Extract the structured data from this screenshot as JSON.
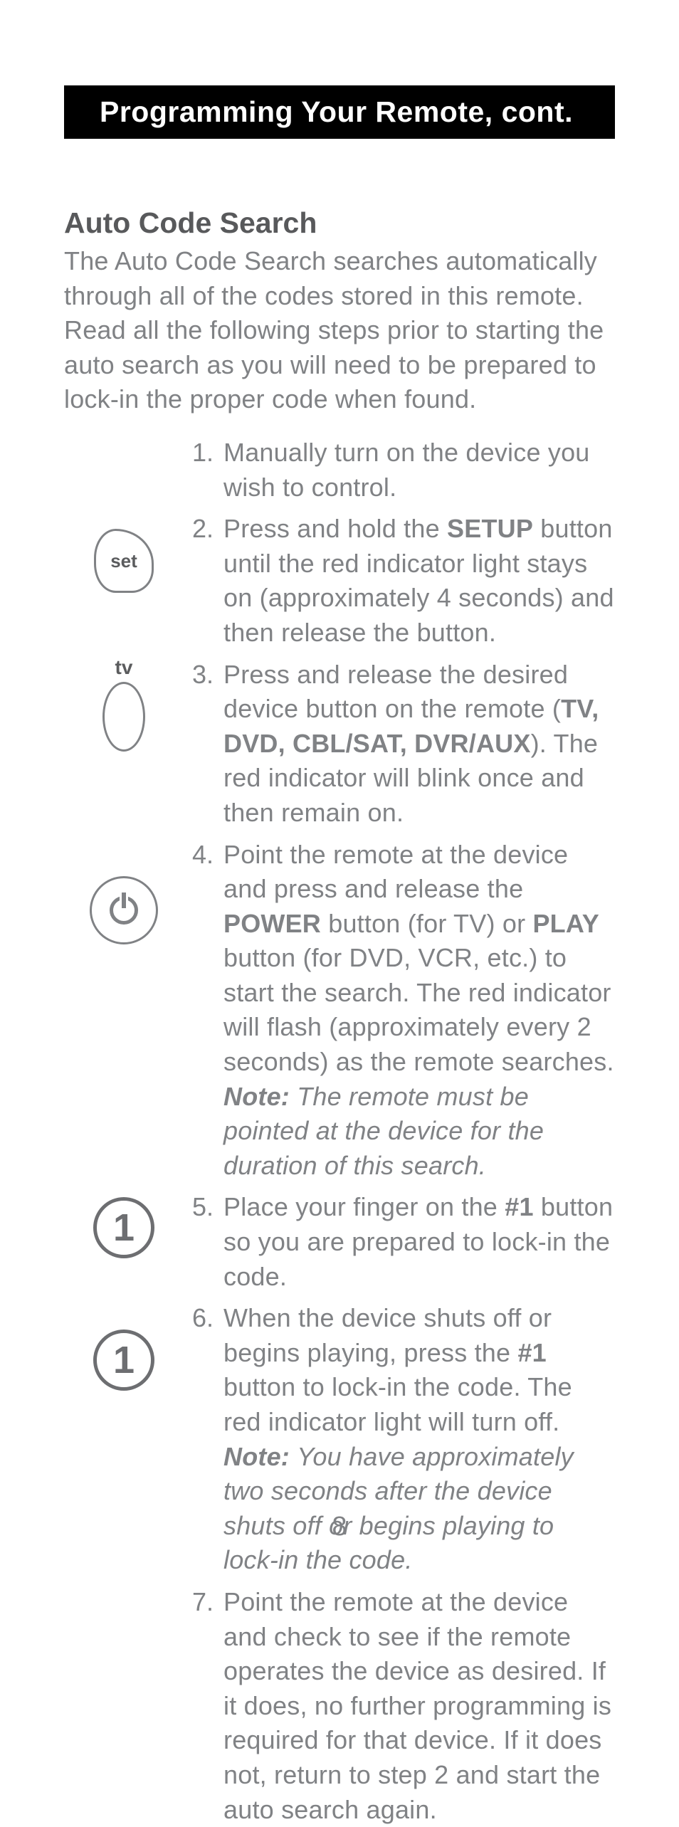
{
  "banner": "Programming Your Remote, cont.",
  "section_title": "Auto Code Search",
  "intro": "The Auto Code Search searches automatically through all of the codes stored in this remote. Read all the following steps prior to starting the auto search as you will need to be prepared to lock-in the proper code when found.",
  "icons": {
    "set_label": "set",
    "tv_label": "tv",
    "one_label": "1"
  },
  "steps": [
    {
      "n": "1.",
      "html": "Manually turn on the device you wish to control."
    },
    {
      "n": "2.",
      "html": "Press and hold the <b>SETUP</b> button until the red indicator light stays on (approximately 4 seconds) and then release the button."
    },
    {
      "n": "3.",
      "html": "Press and release the desired device button on the remote (<b>TV, DVD, CBL/SAT, DVR/AUX</b>). The red indicator will blink once and then remain on."
    },
    {
      "n": "4.",
      "html": "Point the remote at the device and press and release the <b>POWER</b> button (for TV) or <b>PLAY</b> button (for DVD, VCR, etc.) to start the search. The red indicator will flash (approximately every 2 seconds) as the remote searches. <span class=\"nb\">Note:</span> <i>The remote must be pointed at the device for the duration of this search.</i>"
    },
    {
      "n": "5.",
      "html": "Place your finger on the <b>#1</b> button so you are prepared to lock-in the code."
    },
    {
      "n": "6.",
      "html": "When the device shuts off or begins playing, press the <b>#1</b> button to lock-in the code.  The red indicator light will turn off. <span class=\"nb\">Note:</span>  <i>You have approximately two seconds after the device shuts off or begins playing to lock-in the code.</i>"
    },
    {
      "n": "7.",
      "html": "Point the remote at the device and check to see if the remote operates the device as desired. If it does, no further programming is required for that device. If it does not, return to step 2 and start the auto search again."
    }
  ],
  "page_number": "8"
}
